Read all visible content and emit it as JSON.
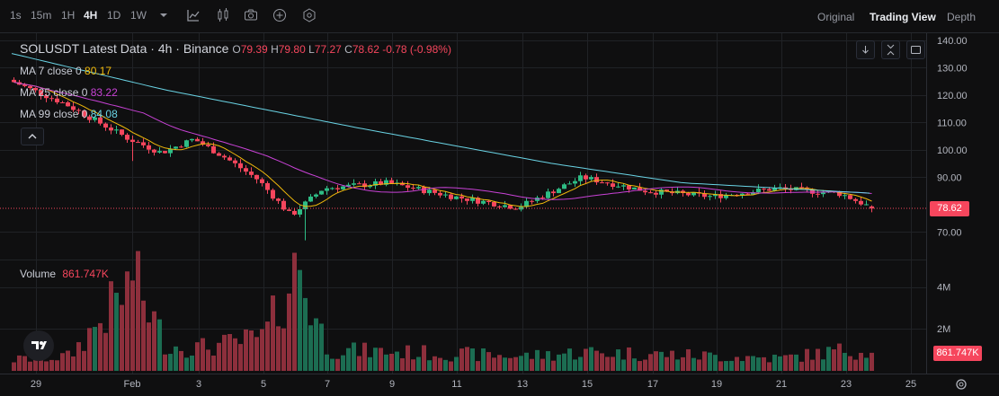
{
  "toolbar": {
    "intervals": [
      "1s",
      "15m",
      "1H",
      "4H",
      "1D",
      "1W"
    ],
    "active_interval": "4H",
    "views": [
      "Original",
      "Trading View",
      "Depth"
    ],
    "active_view": "Trading View"
  },
  "legend": {
    "symbol": "SOLUSDT Latest Data",
    "timeframe": "4h",
    "exchange": "Binance",
    "open_label": "O",
    "open": "79.39",
    "high_label": "H",
    "high": "79.80",
    "low_label": "L",
    "low": "77.27",
    "close_label": "C",
    "close": "78.62",
    "change": "-0.78",
    "change_pct": "(-0.98%)"
  },
  "ma_legend": [
    {
      "label": "MA 7 close 0",
      "value": "80.17",
      "color": "#f0b90b"
    },
    {
      "label": "MA 25 close 0",
      "value": "83.22",
      "color": "#c842d6"
    },
    {
      "label": "MA 99 close 0",
      "value": "84.08",
      "color": "#6ad4e5"
    }
  ],
  "volume_legend": {
    "label": "Volume",
    "value": "861.747K"
  },
  "price_axis": [
    "140.00",
    "130.00",
    "120.00",
    "110.00",
    "100.00",
    "90.00",
    "70.00"
  ],
  "volume_axis": [
    "4M",
    "2M"
  ],
  "time_axis": [
    "29",
    "Feb",
    "3",
    "5",
    "7",
    "9",
    "11",
    "13",
    "15",
    "17",
    "19",
    "21",
    "23",
    "25"
  ],
  "last_price_tag": "78.62",
  "last_volume_tag": "861.747K",
  "colors": {
    "up": "#2ebd85",
    "down": "#f6465d",
    "up_vol": "#1c6d52",
    "down_vol": "#8d2f3c",
    "ma7": "#f0b90b",
    "ma25": "#c842d6",
    "ma99": "#6ad4e5",
    "grid": "#202226"
  },
  "chart_data": {
    "type": "candlestick",
    "price_axis_range": [
      64,
      143
    ],
    "anchors": [
      {
        "x": "Jan 28",
        "price": 127,
        "volume": 0.5
      },
      {
        "x": "Jan 30",
        "price": 117,
        "volume": 0.7
      },
      {
        "x": "Feb 1",
        "price": 104,
        "volume": 4.3
      },
      {
        "x": "Feb 2",
        "price": 99,
        "volume": 1.2
      },
      {
        "x": "Feb 3",
        "price": 104,
        "volume": 1.1
      },
      {
        "x": "Feb 4",
        "price": 97,
        "volume": 1.3
      },
      {
        "x": "Feb 5",
        "price": 89,
        "volume": 1.6
      },
      {
        "x": "Feb 6",
        "price": 76,
        "volume": 4.8
      },
      {
        "x": "Feb 7",
        "price": 86,
        "volume": 1.0
      },
      {
        "x": "Feb 9",
        "price": 88,
        "volume": 0.9
      },
      {
        "x": "Feb 11",
        "price": 83,
        "volume": 0.8
      },
      {
        "x": "Feb 13",
        "price": 79,
        "volume": 0.7
      },
      {
        "x": "Feb 15",
        "price": 90,
        "volume": 0.9
      },
      {
        "x": "Feb 17",
        "price": 85,
        "volume": 0.8
      },
      {
        "x": "Feb 19",
        "price": 83,
        "volume": 0.7
      },
      {
        "x": "Feb 21",
        "price": 86,
        "volume": 0.6
      },
      {
        "x": "Feb 23",
        "price": 84,
        "volume": 1.0
      },
      {
        "x": "Feb 24",
        "price": 78.62,
        "volume": 0.86
      }
    ],
    "ma99_anchors": [
      {
        "x": "Jan 28",
        "price": 136
      },
      {
        "x": "Feb 2",
        "price": 122
      },
      {
        "x": "Feb 8",
        "price": 108
      },
      {
        "x": "Feb 14",
        "price": 95
      },
      {
        "x": "Feb 18",
        "price": 88
      },
      {
        "x": "Feb 24",
        "price": 84.08
      }
    ]
  }
}
